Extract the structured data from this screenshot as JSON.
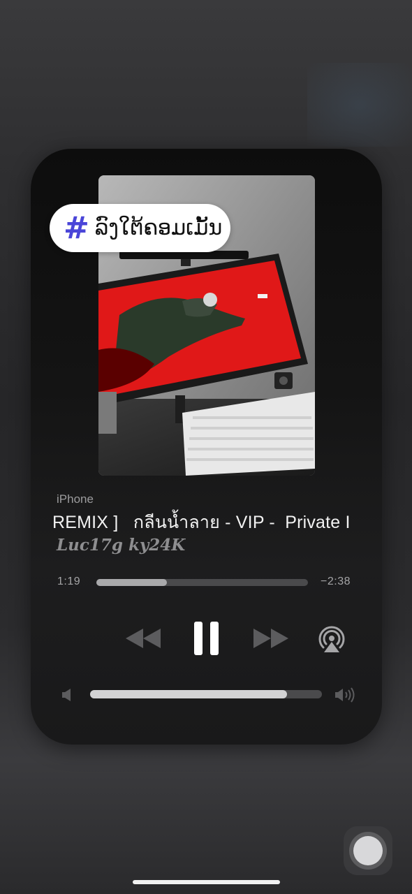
{
  "hashtag": {
    "icon": "hashtag-icon",
    "text": "ລົງໃຕ້ຄອມເມັ້ນ",
    "icon_color": "#4a45d8"
  },
  "player": {
    "device": "iPhone",
    "title": "REMIX ]   กลีนน้ำลาย - VIP -  Private I",
    "artist": "Luc17g ky24K",
    "elapsed": "1:19",
    "remaining": "−2:38",
    "progress": 0.333,
    "volume": 0.85
  },
  "controls": {
    "rewind_icon": "rewind-icon",
    "pause_icon": "pause-icon",
    "forward_icon": "fast-forward-icon",
    "airplay_icon": "airplay-icon",
    "volume_min_icon": "volume-low-icon",
    "volume_max_icon": "volume-high-icon"
  },
  "colors": {
    "background": "#2b2b2d",
    "card": "#141414",
    "text": "#f2f2f2",
    "secondary": "#9c9c9e"
  }
}
